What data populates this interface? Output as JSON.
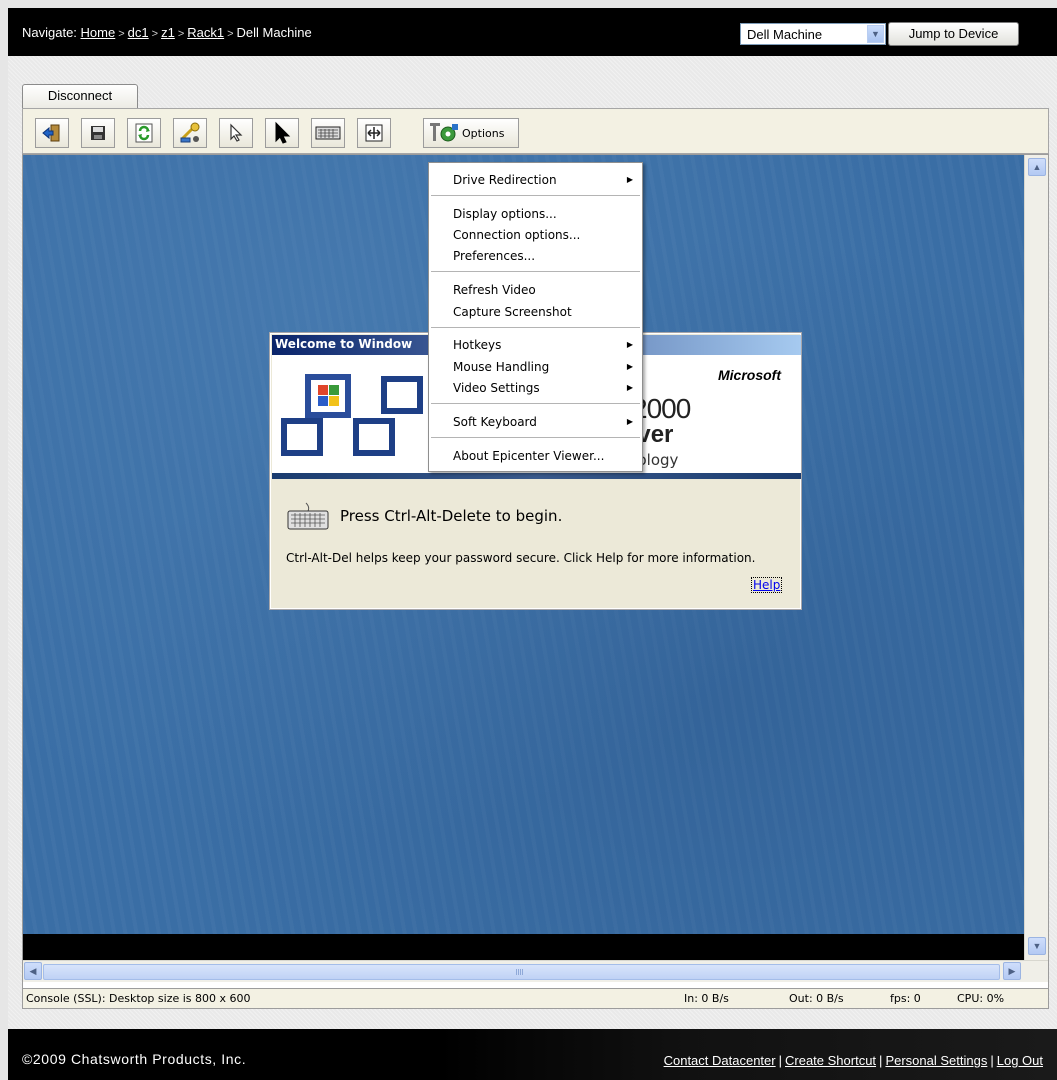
{
  "topbar": {
    "nav_prefix": "Navigate:",
    "breadcrumb": [
      "Home",
      "dc1",
      "z1",
      "Rack1"
    ],
    "current": "Dell Machine",
    "device_select": "Dell Machine",
    "jump_button": "Jump to Device"
  },
  "disconnect_label": "Disconnect",
  "toolbar": {
    "buttons": [
      "exit-icon",
      "save-icon",
      "refresh-icon",
      "key-icon",
      "mouse-pointer-outline-icon",
      "mouse-pointer-icon",
      "keyboard-icon",
      "fit-screen-icon"
    ],
    "options_label": "Options"
  },
  "remote_screen": {
    "dialog_title": "Welcome to Window",
    "ms_logo": "Microsoft",
    "product_2000": "2000",
    "product_server": "rver",
    "product_tech": "nology",
    "press_text": "Press Ctrl-Alt-Delete to begin.",
    "help_text": "Ctrl-Alt-Del helps keep your password secure. Click Help for more information.",
    "help_link": "Help"
  },
  "options_menu": {
    "items": [
      {
        "label": "Drive Redirection",
        "submenu": true
      },
      {
        "label": "Display options...",
        "submenu": false
      },
      {
        "label": "Connection options...",
        "submenu": false
      },
      {
        "label": "Preferences...",
        "submenu": false
      },
      {
        "label": "Refresh Video",
        "submenu": false
      },
      {
        "label": "Capture Screenshot",
        "submenu": false
      },
      {
        "label": "Hotkeys",
        "submenu": true
      },
      {
        "label": "Mouse Handling",
        "submenu": true
      },
      {
        "label": "Video Settings",
        "submenu": true
      },
      {
        "label": "Soft Keyboard",
        "submenu": true
      },
      {
        "label": "About Epicenter Viewer...",
        "submenu": false
      }
    ]
  },
  "status": {
    "console": "Console (SSL): Desktop size is 800 x 600",
    "in": "In: 0 B/s",
    "out": "Out: 0 B/s",
    "fps": "fps: 0",
    "cpu": "CPU: 0%"
  },
  "footer": {
    "copyright": "©2009 Chatsworth Products, Inc.",
    "links": [
      "Contact Datacenter",
      "Create Shortcut",
      "Personal Settings",
      "Log Out"
    ]
  },
  "colors": {
    "desktop_blue": "#3a6ea5",
    "topbar_black": "#000000",
    "toolbar_bg": "#f3f1e3"
  }
}
